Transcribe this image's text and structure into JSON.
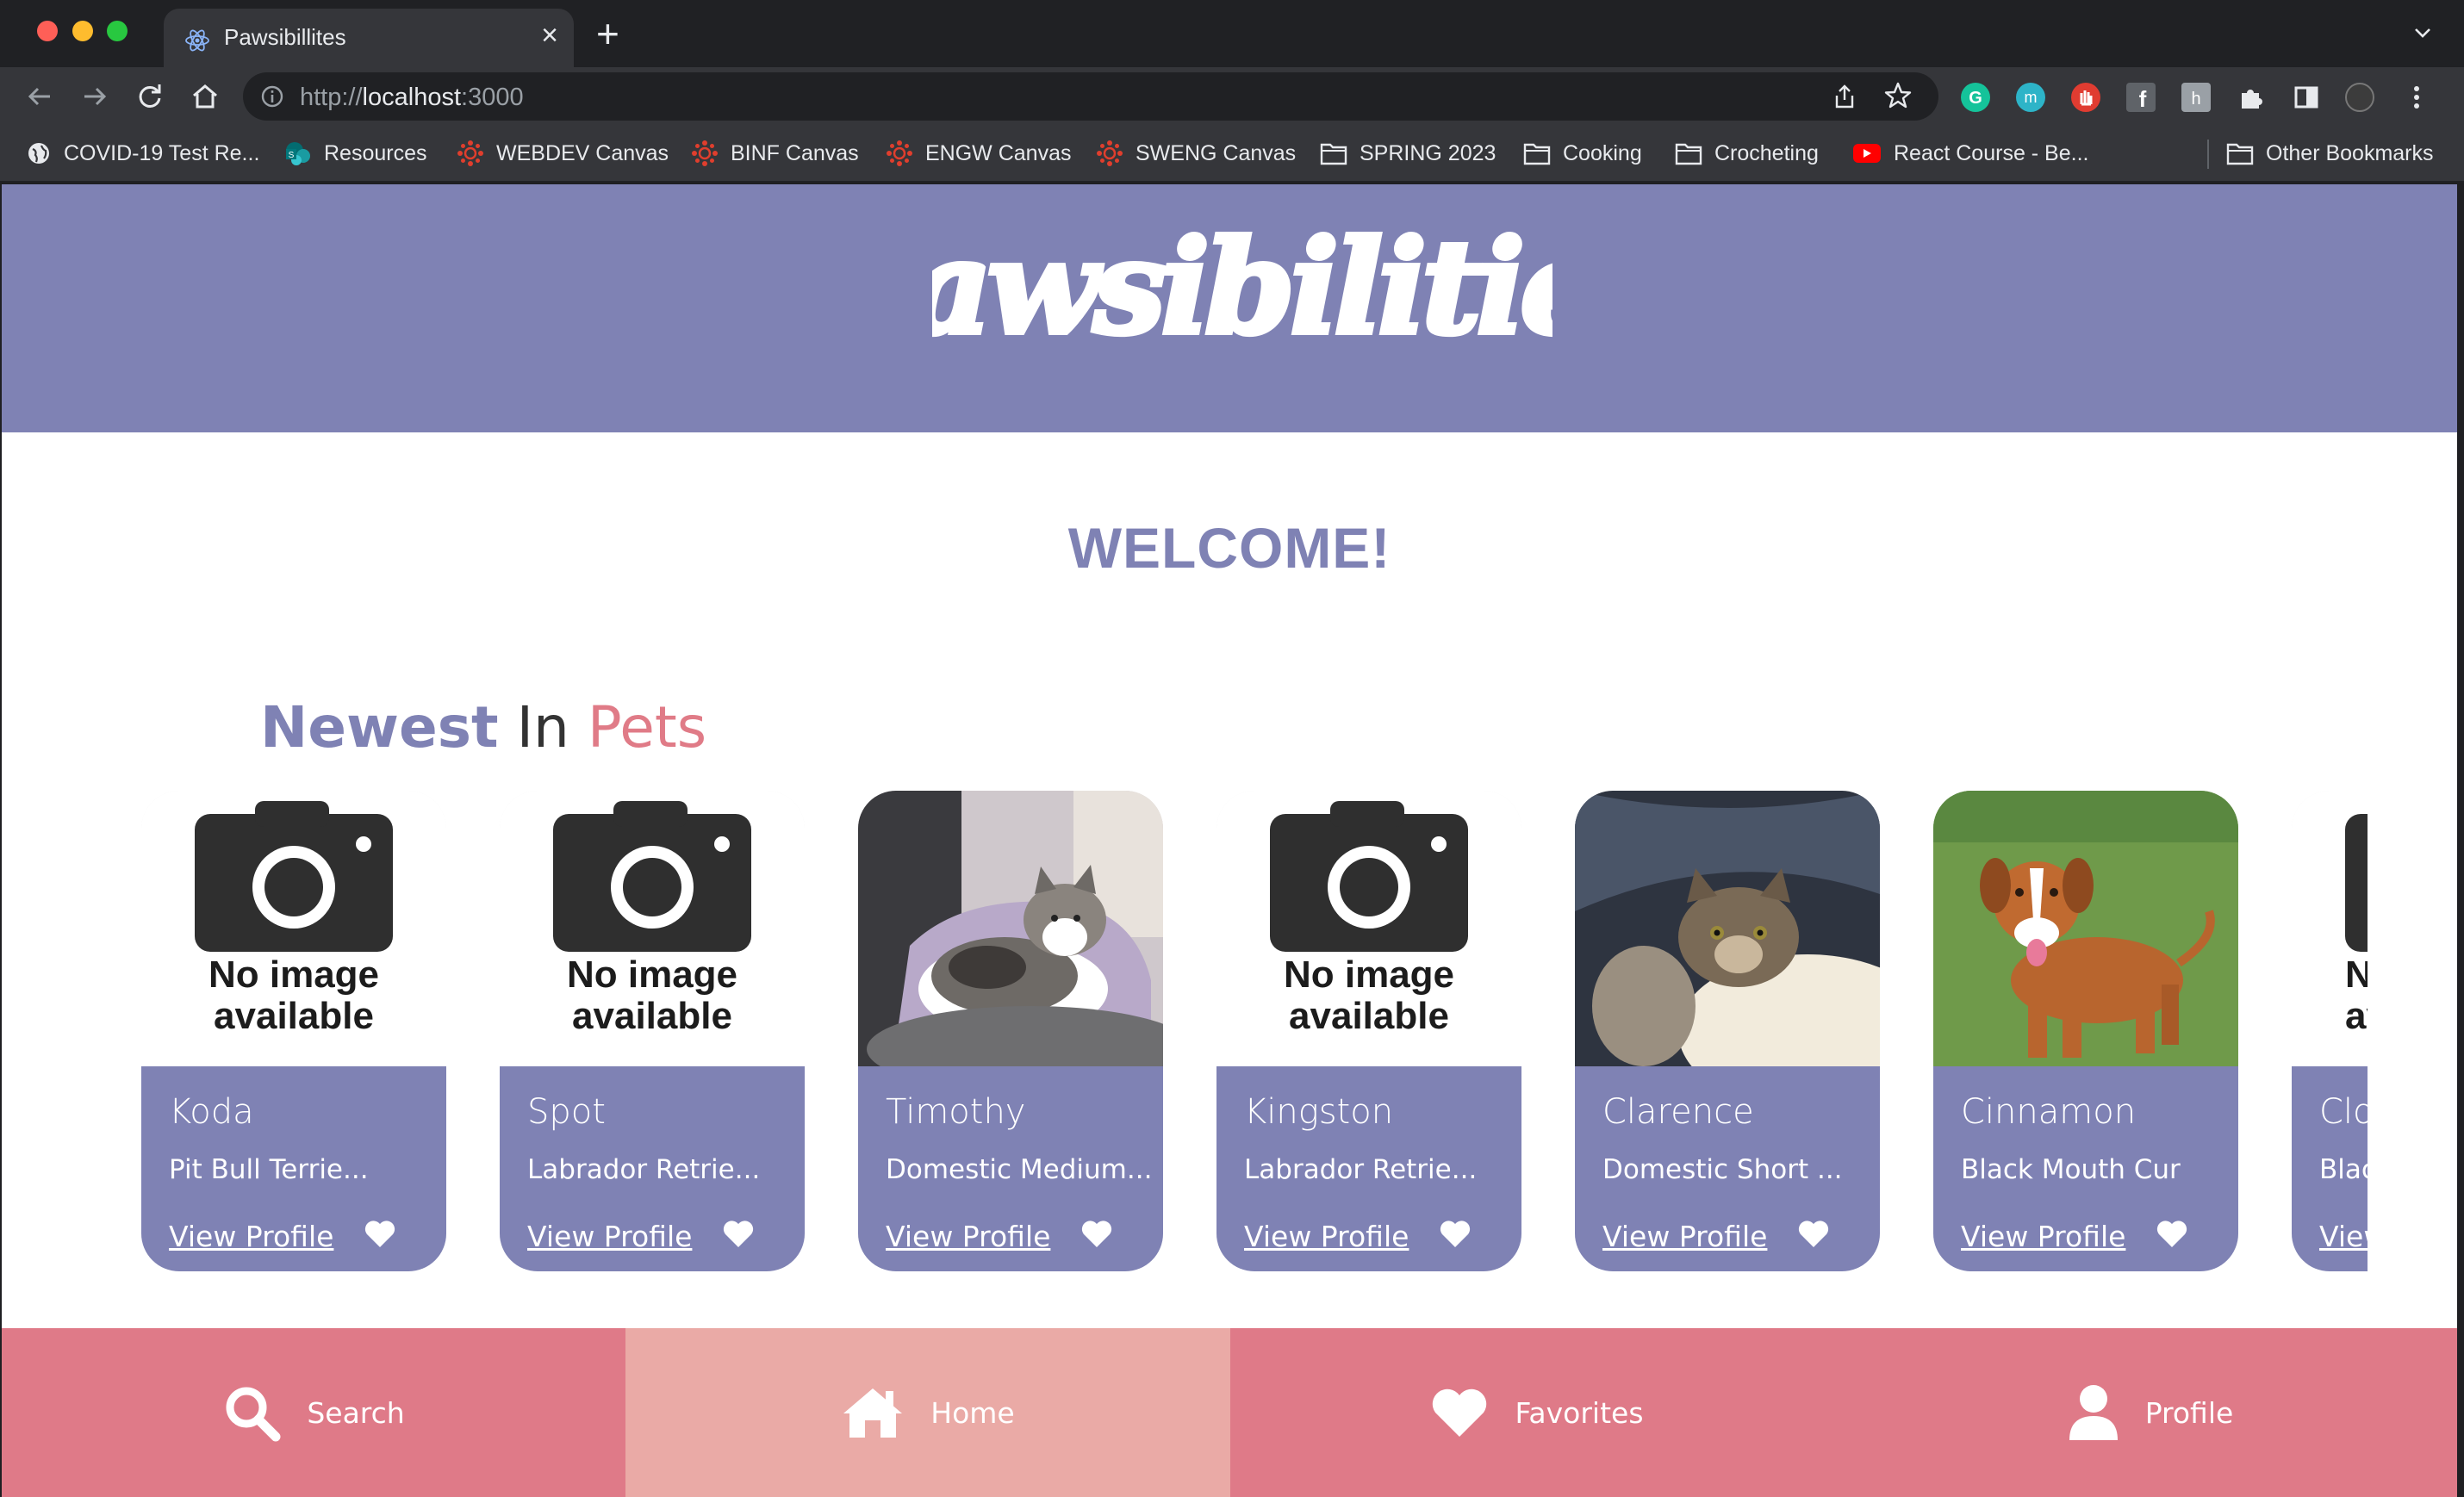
{
  "browser": {
    "tab_title": "Pawsibillites",
    "new_tab_icon": "plus-icon",
    "url_scheme": "http://",
    "url_host": "localhost",
    "url_port": ":3000",
    "bookmarks": [
      {
        "label": "COVID-19 Test Re...",
        "icon": "globe-icon"
      },
      {
        "label": "Resources",
        "icon": "sharepoint-icon"
      },
      {
        "label": "WEBDEV Canvas",
        "icon": "canvas-icon"
      },
      {
        "label": "BINF Canvas",
        "icon": "canvas-icon"
      },
      {
        "label": "ENGW Canvas",
        "icon": "canvas-icon"
      },
      {
        "label": "SWENG Canvas",
        "icon": "canvas-icon"
      },
      {
        "label": "SPRING 2023",
        "icon": "folder-icon"
      },
      {
        "label": "Cooking",
        "icon": "folder-icon"
      },
      {
        "label": "Crocheting",
        "icon": "folder-icon"
      },
      {
        "label": "React Course - Be...",
        "icon": "youtube-icon"
      }
    ],
    "other_bookmarks": "Other Bookmarks"
  },
  "colors": {
    "brand_purple": "#7f82b4",
    "brand_pink": "#df7a88",
    "nav_active": "#eaaaa6"
  },
  "header": {
    "logo_text": "Pawsibilities"
  },
  "main": {
    "welcome": "WELCOME!",
    "section_title_1": "Newest",
    "section_title_2": "In",
    "section_title_3": "Pets",
    "no_image_line1": "No image",
    "no_image_line2": "available",
    "pets": [
      {
        "name": "Koda",
        "breed": "Pit Bull Terrie...",
        "link": "View Profile",
        "photo": "no-image"
      },
      {
        "name": "Spot",
        "breed": "Labrador Retrie...",
        "link": "View Profile",
        "photo": "no-image"
      },
      {
        "name": "Timothy",
        "breed": "Domestic Medium...",
        "link": "View Profile",
        "photo": "cat-tabby-white"
      },
      {
        "name": "Kingston",
        "breed": "Labrador Retrie...",
        "link": "View Profile",
        "photo": "no-image"
      },
      {
        "name": "Clarence",
        "breed": "Domestic Short ...",
        "link": "View Profile",
        "photo": "cat-tabby-dark"
      },
      {
        "name": "Cinnamon",
        "breed": "Black Mouth Cur",
        "link": "View Profile",
        "photo": "dog-brown"
      },
      {
        "name": "Clo",
        "breed": "Blac",
        "link": "View",
        "photo": "no-image-partial"
      }
    ]
  },
  "bottom_nav": [
    {
      "label": "Search",
      "icon": "search-icon"
    },
    {
      "label": "Home",
      "icon": "home-icon"
    },
    {
      "label": "Favorites",
      "icon": "heart-icon"
    },
    {
      "label": "Profile",
      "icon": "user-icon"
    }
  ]
}
